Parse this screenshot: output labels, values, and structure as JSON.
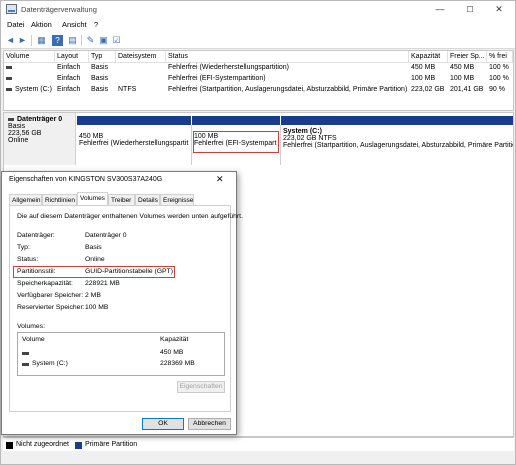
{
  "window": {
    "title": "Datenträgerverwaltung",
    "minimize": "—",
    "maximize": "☐",
    "close": "✕"
  },
  "menu": [
    "Datei",
    "Aktion",
    "Ansicht",
    "?"
  ],
  "toolbar": {
    "back": "◄",
    "forward": "►",
    "tb1": "▦",
    "tb2": "?",
    "tb3": "▤",
    "tb4": "✎",
    "tb5": "▣",
    "tb6": "☑"
  },
  "volume_table": {
    "headers": [
      "Volume",
      "Layout",
      "Typ",
      "Dateisystem",
      "Status",
      "Kapazität",
      "Freier Sp...",
      "% frei"
    ],
    "rows": [
      {
        "volume": "",
        "layout": "Einfach",
        "typ": "Basis",
        "fs": "",
        "status": "Fehlerfrei (Wiederherstellungspartition)",
        "cap": "450 MB",
        "free": "450 MB",
        "pct": "100 %"
      },
      {
        "volume": "",
        "layout": "Einfach",
        "typ": "Basis",
        "fs": "",
        "status": "Fehlerfrei (EFI-Systempartition)",
        "cap": "100 MB",
        "free": "100 MB",
        "pct": "100 %"
      },
      {
        "volume": "System (C:)",
        "layout": "Einfach",
        "typ": "Basis",
        "fs": "NTFS",
        "status": "Fehlerfrei (Startpartition, Auslagerungsdatei, Absturzabbild, Primäre Partition)",
        "cap": "223,02 GB",
        "free": "201,41 GB",
        "pct": "90 %"
      }
    ]
  },
  "disk": {
    "name": "Datenträger 0",
    "type": "Basis",
    "size": "223,56 GB",
    "state": "Online",
    "partitions": [
      {
        "size": "450 MB",
        "status": "Fehlerfrei (Wiederherstellungspartit"
      },
      {
        "size": "100 MB",
        "status": "Fehlerfrei (EFI-Systempart"
      },
      {
        "name": "System  (C:)",
        "size": "223,02 GB NTFS",
        "status": "Fehlerfrei (Startpartition, Auslagerungsdatei, Absturzabbild, Primäre Partition)"
      }
    ]
  },
  "legend": {
    "unallocated": "Nicht zugeordnet",
    "primary": "Primäre Partition",
    "unallocated_color": "#000000",
    "primary_color": "#1a3c8c"
  },
  "dialog": {
    "title": "Eigenschaften von KINGSTON SV300S37A240G",
    "close": "✕",
    "tabs": [
      "Allgemein",
      "Richtlinien",
      "Volumes",
      "Treiber",
      "Details",
      "Ereignisse"
    ],
    "active_tab": "Volumes",
    "intro": "Die auf diesem Datenträger enthaltenen Volumes werden unten aufgeführt.",
    "fields": [
      {
        "label": "Datenträger:",
        "value": "Datenträger 0"
      },
      {
        "label": "Typ:",
        "value": "Basis"
      },
      {
        "label": "Status:",
        "value": "Online"
      },
      {
        "label": "Partitionsstil:",
        "value": "GUID-Partitionstabelle (GPT)"
      },
      {
        "label": "Speicherkapazität:",
        "value": "228921 MB"
      },
      {
        "label": "Verfügbarer Speicher:",
        "value": "2 MB"
      },
      {
        "label": "Reservierter Speicher:",
        "value": "100 MB"
      }
    ],
    "volumes_label": "Volumes:",
    "vol_headers": [
      "Volume",
      "Kapazität"
    ],
    "vol_rows": [
      {
        "name": "",
        "cap": "450 MB"
      },
      {
        "name": "System (C:)",
        "cap": "228369 MB"
      }
    ],
    "properties_button": "Eigenschaften",
    "ok": "OK",
    "cancel": "Abbrechen"
  }
}
